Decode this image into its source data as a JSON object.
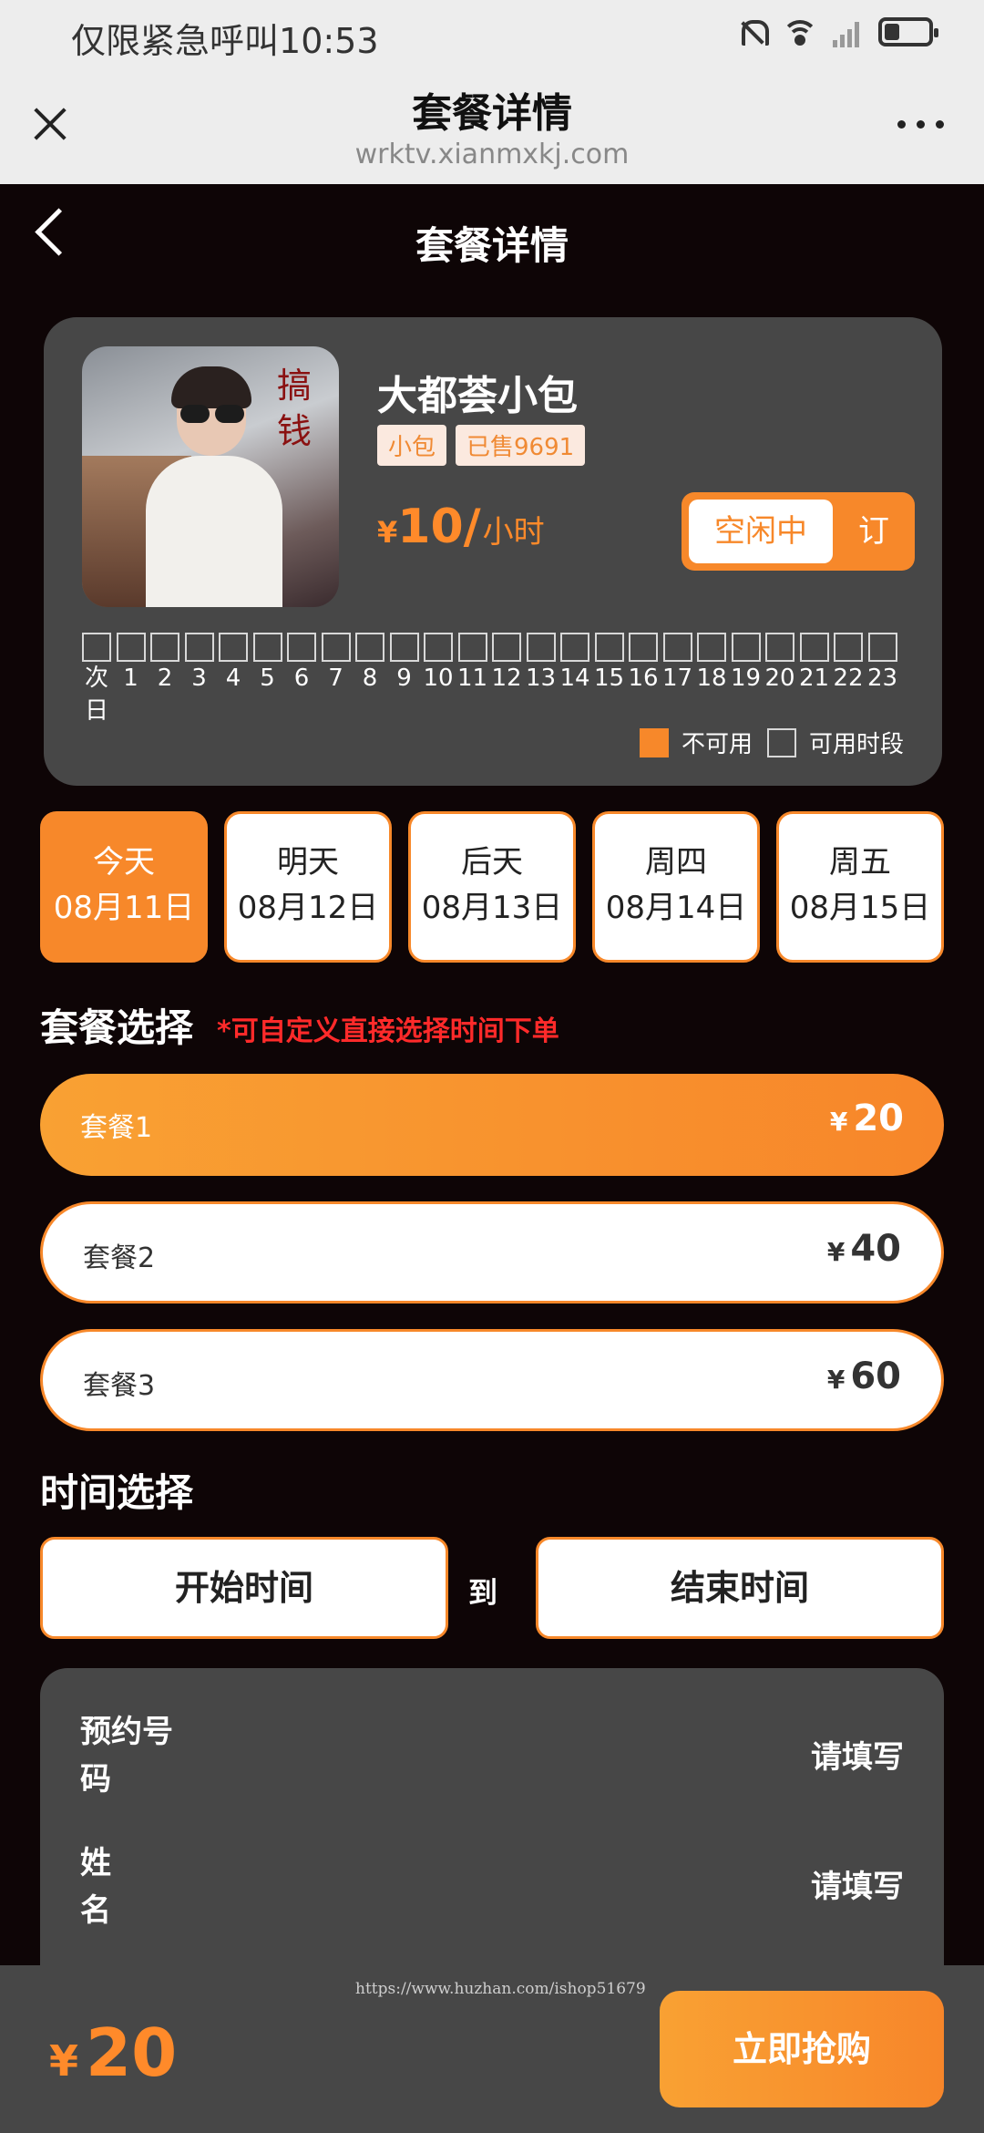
{
  "status_bar": {
    "carrier_text": "仅限紧急呼叫",
    "time": "10:53"
  },
  "browser": {
    "title": "套餐详情",
    "url": "wrktv.xianmxkj.com"
  },
  "page": {
    "title": "套餐详情"
  },
  "product": {
    "name": "大都荟小包",
    "tags": [
      "小包",
      "已售9691"
    ],
    "price_currency": "¥",
    "price_value": "10/",
    "price_unit": "小时",
    "status_label": "空闲中",
    "book_label": "订",
    "image_calligraphy": "搞钱"
  },
  "hours": [
    "次\n日",
    "1",
    "2",
    "3",
    "4",
    "5",
    "6",
    "7",
    "8",
    "9",
    "10",
    "11",
    "12",
    "13",
    "14",
    "15",
    "16",
    "17",
    "18",
    "19",
    "20",
    "21",
    "22",
    "23"
  ],
  "legend": {
    "unavailable": "不可用",
    "available": "可用时段"
  },
  "dates": [
    {
      "day": "今天",
      "date": "08月11日",
      "active": true
    },
    {
      "day": "明天",
      "date": "08月12日",
      "active": false
    },
    {
      "day": "后天",
      "date": "08月13日",
      "active": false
    },
    {
      "day": "周四",
      "date": "08月14日",
      "active": false
    },
    {
      "day": "周五",
      "date": "08月15日",
      "active": false
    }
  ],
  "packages_section": {
    "title": "套餐选择",
    "note": "*可自定义直接选择时间下单"
  },
  "packages": [
    {
      "name": "套餐1",
      "currency": "¥",
      "price": "20",
      "active": true
    },
    {
      "name": "套餐2",
      "currency": "¥",
      "price": "40",
      "active": false
    },
    {
      "name": "套餐3",
      "currency": "¥",
      "price": "60",
      "active": false
    }
  ],
  "time_section": {
    "title": "时间选择",
    "start": "开始时间",
    "to": "到",
    "end": "结束时间"
  },
  "form": {
    "phone_label": "预约号码",
    "phone_placeholder": "请填写",
    "name_label": "姓名",
    "name_placeholder": "请填写"
  },
  "footer": {
    "currency": "¥",
    "total": "20",
    "watermark": "https://www.huzhan.com/ishop51679",
    "buy_label": "立即抢购"
  },
  "colors": {
    "accent": "#f7882a",
    "background": "#0e0506",
    "card": "#474747",
    "note": "#ff2a2a"
  }
}
